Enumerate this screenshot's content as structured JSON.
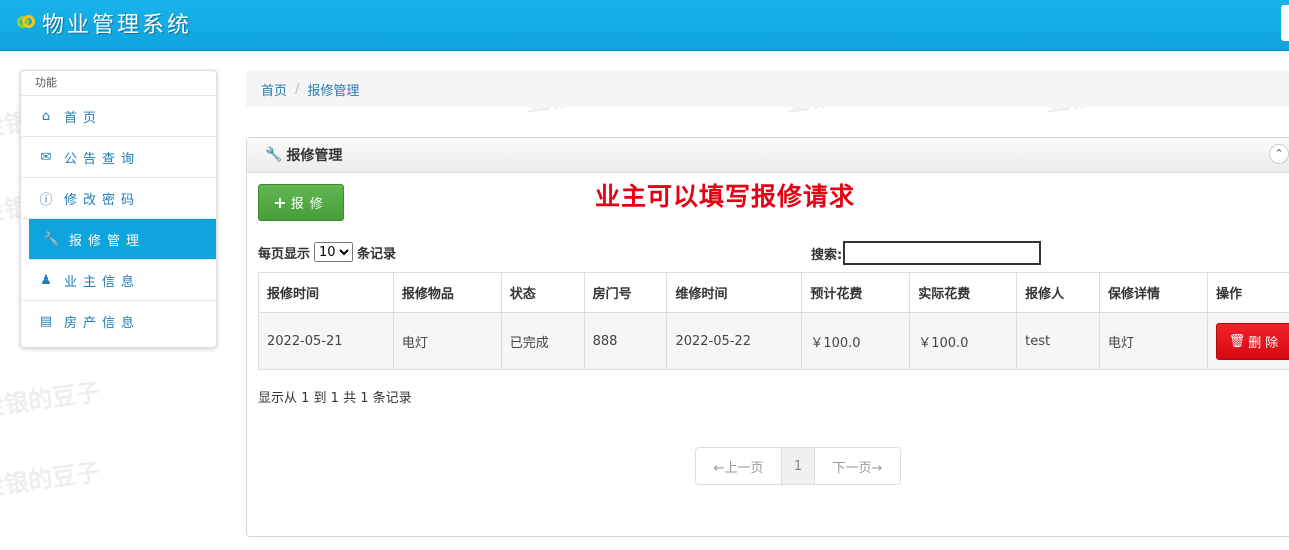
{
  "app": {
    "title": "物业管理系统"
  },
  "sidebar": {
    "heading": "功能",
    "items": [
      {
        "label": "首页",
        "icon": "home-icon"
      },
      {
        "label": "公告查询",
        "icon": "envelope-icon"
      },
      {
        "label": "修改密码",
        "icon": "info-icon"
      },
      {
        "label": "报修管理",
        "icon": "wrench-icon",
        "active": true
      },
      {
        "label": "业主信息",
        "icon": "user-icon"
      },
      {
        "label": "房产信息",
        "icon": "list-icon"
      }
    ]
  },
  "breadcrumb": {
    "home": "首页",
    "separator": "/",
    "current": "报修管理"
  },
  "panel": {
    "title": "报修管理",
    "add_button": "报修",
    "annotation": "业主可以填写报修请求",
    "length_prefix": "每页显示",
    "length_value": "10",
    "length_suffix": "条记录",
    "search_label": "搜索:",
    "search_value": "",
    "columns": [
      "报修时间",
      "报修物品",
      "状态",
      "房门号",
      "维修时间",
      "预计花费",
      "实际花费",
      "报修人",
      "保修详情",
      "操作"
    ],
    "rows": [
      {
        "report_time": "2022-05-21",
        "item": "电灯",
        "status": "已完成",
        "room": "888",
        "repair_time": "2022-05-22",
        "estimated_cost": "￥100.0",
        "actual_cost": "￥100.0",
        "reporter": "test",
        "details": "电灯",
        "delete_label": "删除"
      }
    ],
    "info": "显示从 1 到 1 共 1 条记录",
    "pager": {
      "prev": "←上一页",
      "page": "1",
      "next": "下一页→"
    }
  },
  "watermark": "金银的豆子",
  "colors": {
    "header": "#0ea4de",
    "active": "#0ea4de",
    "add": "#479d3a",
    "delete": "#d6070f",
    "annotation": "#e60012"
  }
}
